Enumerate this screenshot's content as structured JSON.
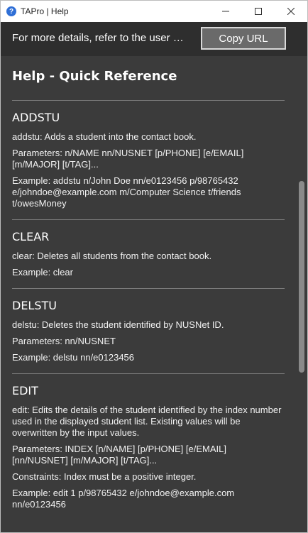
{
  "window": {
    "title": "TAPro | Help"
  },
  "topbar": {
    "message": "For more details, refer to the user guide: ",
    "copy_label": "Copy URL"
  },
  "help": {
    "title": "Help - Quick Reference",
    "sections": [
      {
        "name": "ADDSTU",
        "lines": [
          "addstu: Adds a student into the contact book.",
          "Parameters: n/NAME nn/NUSNET [p/PHONE] [e/EMAIL] [m/MAJOR] [t/TAG]...",
          "Example: addstu n/John Doe nn/e0123456 p/98765432 e/johndoe@example.com m/Computer Science t/friends t/owesMoney"
        ]
      },
      {
        "name": "CLEAR",
        "lines": [
          "clear: Deletes all students from the contact book.",
          "Example: clear"
        ]
      },
      {
        "name": "DELSTU",
        "lines": [
          "delstu: Deletes the student identified by NUSNet ID.",
          "Parameters: nn/NUSNET",
          "Example: delstu nn/e0123456"
        ]
      },
      {
        "name": "EDIT",
        "lines": [
          "edit: Edits the details of the student identified by the index number used in the displayed student list. Existing values will be overwritten by the input values.",
          "Parameters: INDEX [n/NAME] [p/PHONE] [e/EMAIL] [nn/NUSNET] [m/MAJOR] [t/TAG]...",
          "Constraints: Index must be a positive integer.",
          "Example: edit 1 p/98765432 e/johndoe@example.com nn/e0123456"
        ]
      }
    ]
  }
}
